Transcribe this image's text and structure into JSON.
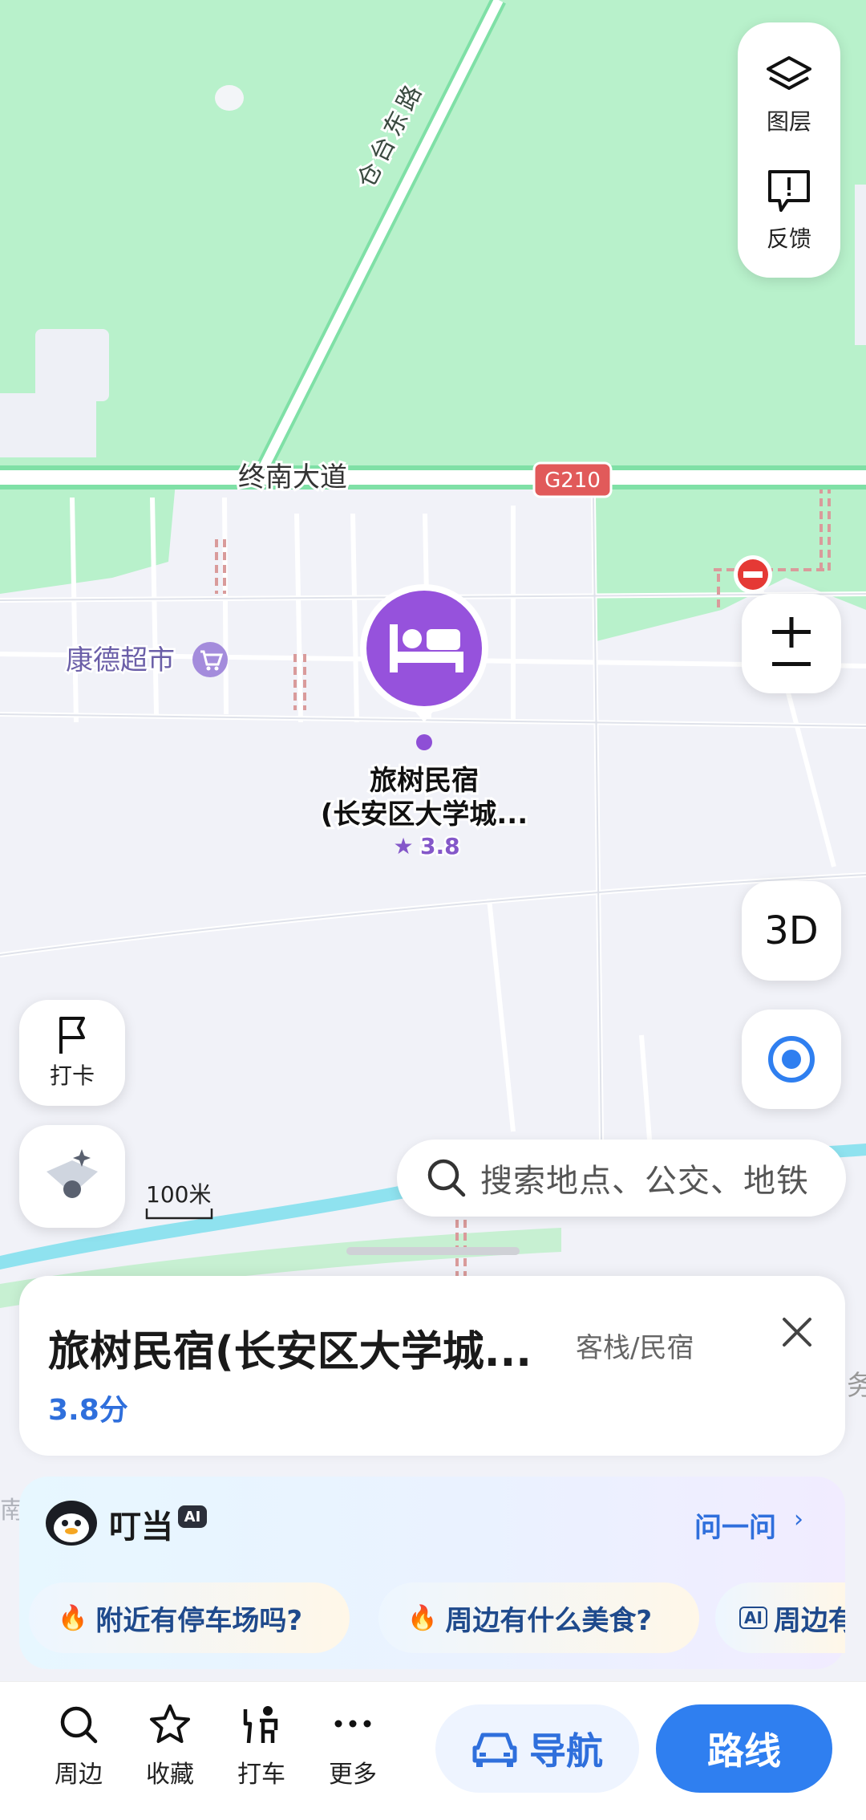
{
  "map": {
    "road_labels": [
      "仓台东路",
      "终南大道",
      "G210"
    ],
    "poi_supermarket": "康德超市",
    "hotel_marker": {
      "name_line1": "旅树民宿",
      "name_line2": "(长安区大学城...",
      "rating": "3.8"
    },
    "scale_label": "100米",
    "edge_label": "务",
    "edge_label_left": "南阝",
    "colors": {
      "green": "#b7f2cc",
      "road": "#ffffff",
      "road_edge": "#7fe1a7",
      "river": "#8ee3f0",
      "hotel": "#9a5ae0"
    }
  },
  "controls": {
    "layers_label": "图层",
    "feedback_label": "反馈",
    "btn_3d": "3D",
    "checkin_label": "打卡"
  },
  "search": {
    "placeholder": "搜索地点、公交、地铁"
  },
  "place_card": {
    "title": "旅树民宿(长安区大学城...",
    "category": "客栈/民宿",
    "rating": "3.8分"
  },
  "ai_card": {
    "name": "叮当",
    "badge": "AI",
    "ask": "问一问",
    "ask_arrow": "›",
    "chips": [
      "附近有停车场吗?",
      "周边有什么美食?",
      "周边有"
    ]
  },
  "bottom_bar": {
    "tabs": [
      "周边",
      "收藏",
      "打车",
      "更多"
    ],
    "navigate": "导航",
    "route": "路线"
  }
}
